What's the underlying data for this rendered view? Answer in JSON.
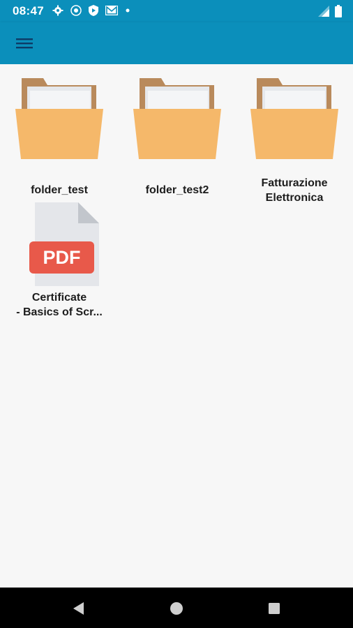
{
  "status_bar": {
    "time": "08:47",
    "icons": [
      "settings-icon",
      "vpn-key-icon",
      "shield-icon",
      "gmail-icon",
      "notification-dot-icon"
    ],
    "right_icons": [
      "signal-icon",
      "battery-icon"
    ]
  },
  "app_bar": {
    "menu_icon": "hamburger-menu-icon",
    "color": "#0b8fbb"
  },
  "files": [
    {
      "type": "folder",
      "name": "folder_test"
    },
    {
      "type": "folder",
      "name": "folder_test2"
    },
    {
      "type": "folder",
      "name": "Fatturazione\nElettronica"
    },
    {
      "type": "pdf",
      "name": "Certificate\n- Basics of Scr...",
      "badge": "PDF"
    }
  ],
  "nav_bar": {
    "buttons": [
      "back-icon",
      "home-icon",
      "recents-icon"
    ]
  },
  "colors": {
    "folder_front": "#f5b86a",
    "folder_back": "#b98a5c",
    "pdf_badge": "#e8594a",
    "pdf_page": "#e4e6ea"
  }
}
